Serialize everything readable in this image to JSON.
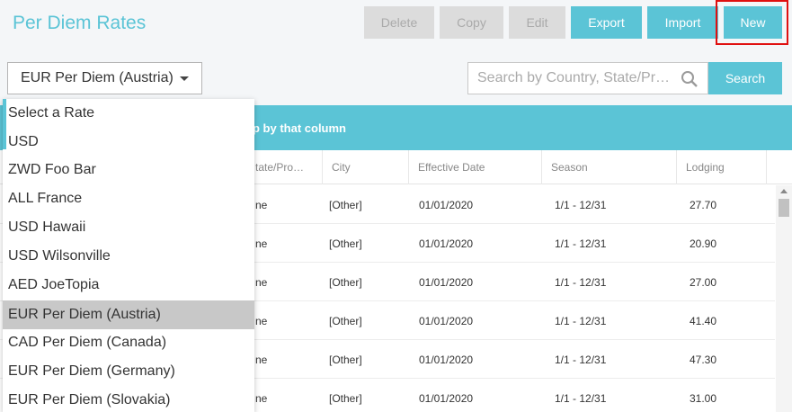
{
  "page": {
    "title": "Per Diem Rates"
  },
  "toolbar": {
    "buttons": [
      {
        "label": "Delete",
        "state": "disabled"
      },
      {
        "label": "Copy",
        "state": "disabled"
      },
      {
        "label": "Edit",
        "state": "disabled"
      },
      {
        "label": "Export",
        "state": "enabled"
      },
      {
        "label": "Import",
        "state": "enabled"
      },
      {
        "label": "New",
        "state": "enabled",
        "highlighted": true
      }
    ]
  },
  "rate_select": {
    "selected": "EUR Per Diem (Austria)",
    "options": [
      "Select a Rate",
      "USD",
      "ZWD Foo Bar",
      "ALL France",
      "USD Hawaii",
      "USD Wilsonville",
      "AED JoeTopia",
      "EUR Per Diem (Austria)",
      "CAD Per Diem (Canada)",
      "EUR Per Diem (Germany)",
      "EUR Per Diem (Slovakia)"
    ]
  },
  "search": {
    "placeholder": "Search by Country, State/Pr…",
    "button_label": "Search"
  },
  "group_bar": {
    "text": "p by that column"
  },
  "table": {
    "columns": [
      "tate/Pro…",
      "City",
      "Effective Date",
      "Season",
      "Lodging"
    ],
    "rows": [
      {
        "state": "ne",
        "city": "[Other]",
        "effective_date": "01/01/2020",
        "season": "1/1 - 12/31",
        "lodging": "27.70"
      },
      {
        "state": "ne",
        "city": "[Other]",
        "effective_date": "01/01/2020",
        "season": "1/1 - 12/31",
        "lodging": "20.90"
      },
      {
        "state": "ne",
        "city": "[Other]",
        "effective_date": "01/01/2020",
        "season": "1/1 - 12/31",
        "lodging": "27.00"
      },
      {
        "state": "ne",
        "city": "[Other]",
        "effective_date": "01/01/2020",
        "season": "1/1 - 12/31",
        "lodging": "41.40"
      },
      {
        "state": "ne",
        "city": "[Other]",
        "effective_date": "01/01/2020",
        "season": "1/1 - 12/31",
        "lodging": "47.30"
      },
      {
        "state": "ne",
        "city": "[Other]",
        "effective_date": "01/01/2020",
        "season": "1/1 - 12/31",
        "lodging": "31.00"
      }
    ]
  },
  "colors": {
    "accent": "#5bc4d6",
    "highlight_outline": "#e01010",
    "disabled_button": "#dcdcdc",
    "selected_option": "#c8c8c8"
  }
}
